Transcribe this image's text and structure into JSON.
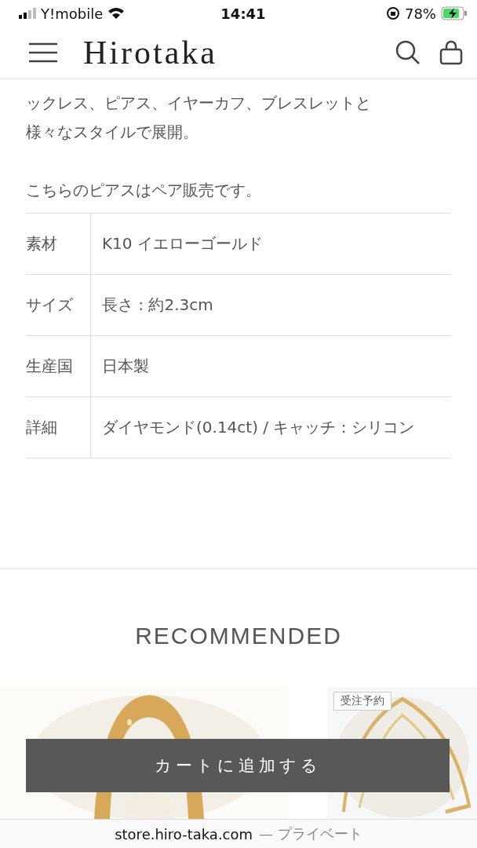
{
  "status_bar": {
    "carrier": "Y!mobile",
    "time": "14:41",
    "battery": "78%"
  },
  "header": {
    "logo": "Hirotaka"
  },
  "description": [
    [
      "ックレス、ピアス、イヤーカフ、ブレスレットと",
      "様々なスタイルで展開。"
    ],
    [
      "こちらのピアスはペア販売です。"
    ]
  ],
  "spec_table": {
    "rows": [
      {
        "label": "素材",
        "value": "K10 イエローゴールド"
      },
      {
        "label": "サイズ",
        "value": "長さ : 約2.3cm"
      },
      {
        "label": "生産国",
        "value": "日本製"
      },
      {
        "label": "詳細",
        "value": "ダイヤモンド(0.14ct) / キャッチ : シリコン"
      }
    ]
  },
  "recommended": {
    "title": "RECOMMENDED",
    "products": [
      {
        "kind": "picture"
      },
      {
        "kind": "picture",
        "badge": "受注予約"
      }
    ]
  },
  "cart_button": "カートに追加する",
  "browser_bar": {
    "domain": "store.hiro-taka.com",
    "suffix": "— プライベート"
  }
}
